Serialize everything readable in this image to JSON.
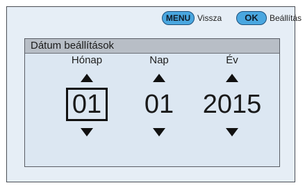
{
  "hints": {
    "back_key": "MENU",
    "back_label": "Vissza",
    "ok_key": "OK",
    "ok_label": "Beállítás"
  },
  "panel": {
    "title": "Dátum beállítások",
    "fields": [
      {
        "label": "Hónap",
        "value": "01",
        "selected": true
      },
      {
        "label": "Nap",
        "value": "01",
        "selected": false
      },
      {
        "label": "Év",
        "value": "2015",
        "selected": false
      }
    ]
  }
}
